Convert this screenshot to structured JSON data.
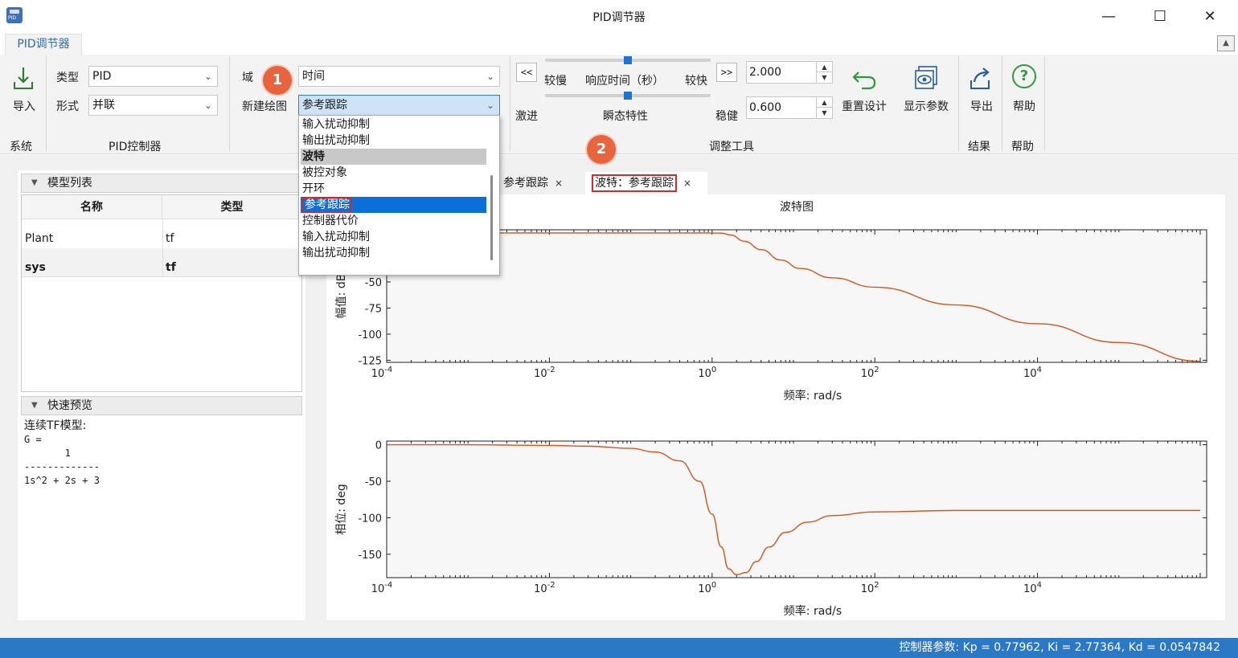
{
  "window": {
    "title": "PID调节器",
    "app_icon_text": "PID",
    "minimize_glyph": "—",
    "maximize_glyph": "☐",
    "close_glyph": "✕"
  },
  "ribbon": {
    "tab_label": "PID调节器",
    "collapse_glyph": "▲",
    "system": {
      "import_label": "导入",
      "group_label": "系统"
    },
    "pid_controller": {
      "type_label": "类型",
      "type_value": "PID",
      "form_label": "形式",
      "form_value": "并联",
      "group_label": "PID控制器"
    },
    "domain": {
      "domain_label": "域",
      "domain_value": "时间",
      "new_plot_label": "新建绘图",
      "new_plot_value": "参考跟踪"
    },
    "tuning": {
      "slower_btn": "<<",
      "faster_btn": ">>",
      "slower_label": "较慢",
      "response_time_label": "响应时间（秒）",
      "faster_label": "较快",
      "response_time_value": "2.000",
      "aggressive_label": "激进",
      "transient_label": "瞬态特性",
      "robust_label": "稳健",
      "transient_value": "0.600",
      "response_slider_fraction": 0.5,
      "transient_slider_fraction": 0.5,
      "reset_label": "重置设计",
      "show_params_label": "显示参数",
      "group_label": "调整工具"
    },
    "results": {
      "export_label": "导出",
      "group_label": "结果"
    },
    "help": {
      "help_label": "帮助",
      "group_label": "帮助",
      "help_glyph": "?"
    }
  },
  "annotations": {
    "badge1": "1",
    "badge2": "2"
  },
  "dropdown": {
    "items": [
      {
        "label": "输入扰动抑制",
        "kind": "item"
      },
      {
        "label": "输出扰动抑制",
        "kind": "item"
      },
      {
        "label": "波特",
        "kind": "header"
      },
      {
        "label": "被控对象",
        "kind": "item"
      },
      {
        "label": "开环",
        "kind": "item"
      },
      {
        "label": "参考跟踪",
        "kind": "selected"
      },
      {
        "label": "控制器代价",
        "kind": "item"
      },
      {
        "label": "输入扰动抑制",
        "kind": "item"
      },
      {
        "label": "输出扰动抑制",
        "kind": "item"
      }
    ]
  },
  "left": {
    "model_list_title": "模型列表",
    "columns": [
      "名称",
      "类型"
    ],
    "rows": [
      {
        "name": "Plant",
        "type": "tf",
        "bold": false
      },
      {
        "name": "sys",
        "type": "tf",
        "bold": true
      }
    ],
    "preview_title": "快速预览",
    "preview_lines": [
      "连续TF模型:",
      "G =",
      "       1",
      "-------------",
      "1s^2 + 2s + 3"
    ]
  },
  "doc_tabs": [
    {
      "label": "参考跟踪",
      "close": "×",
      "active": false
    },
    {
      "label": "波特：参考跟踪",
      "close": "×",
      "active": true
    }
  ],
  "chart_data": [
    {
      "type": "line",
      "title": "波特图",
      "xlabel": "频率: rad/s",
      "ylabel": "幅值: dB",
      "xscale": "log",
      "xlim": [
        0.0001,
        1200000
      ],
      "ylim": [
        -127,
        0
      ],
      "x_ticks": [
        "10-4",
        "10-2",
        "100",
        "102",
        "104"
      ],
      "y_ticks": [
        -50,
        -75,
        -100,
        -125
      ],
      "grid": false,
      "color": "#d95319",
      "series": [
        {
          "x": [
            0.0001,
            0.01,
            0.3,
            0.8,
            1.3,
            1.7,
            2.5,
            4,
            7,
            12,
            30,
            100,
            1000,
            10000,
            100000,
            1000000
          ],
          "y": [
            -3,
            -3,
            -3,
            -3,
            -3.2,
            -5,
            -11,
            -19,
            -29,
            -37,
            -46,
            -55,
            -72,
            -90,
            -108,
            -126
          ]
        }
      ]
    },
    {
      "type": "line",
      "title": "",
      "xlabel": "频率: rad/s",
      "ylabel": "相位: deg",
      "xscale": "log",
      "xlim": [
        0.0001,
        1200000
      ],
      "ylim": [
        -182,
        5
      ],
      "x_ticks": [
        "10-4",
        "10-2",
        "100",
        "102",
        "104"
      ],
      "y_ticks": [
        0,
        -50,
        -100,
        -150
      ],
      "grid": false,
      "color": "#d95319",
      "series": [
        {
          "x": [
            0.0001,
            0.001,
            0.01,
            0.03,
            0.1,
            0.2,
            0.4,
            0.7,
            1.0,
            1.3,
            1.6,
            2.0,
            2.6,
            3.5,
            5,
            8,
            15,
            30,
            100,
            1000,
            10000,
            100000,
            1000000
          ],
          "y": [
            0,
            0,
            -1,
            -2,
            -5,
            -10,
            -22,
            -50,
            -95,
            -140,
            -170,
            -178,
            -175,
            -160,
            -140,
            -120,
            -106,
            -97,
            -92,
            -90,
            -90,
            -90,
            -90
          ]
        }
      ]
    }
  ],
  "status": {
    "text": "控制器参数:  Kp = 0.77962, Ki = 2.77364, Kd = 0.0547842"
  },
  "colors": {
    "accent": "#2b78c4",
    "badge": "#e8643c",
    "curve": "#d95319",
    "selection": "#0a6fd8"
  }
}
